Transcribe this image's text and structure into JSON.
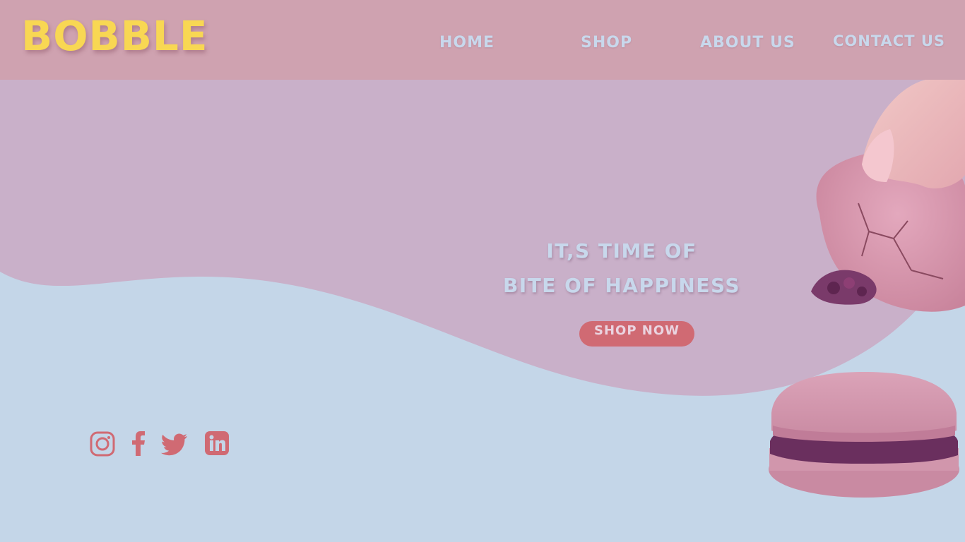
{
  "brand": {
    "name": "BOBBLE",
    "color": "#f8d753"
  },
  "nav": {
    "home": "HOME",
    "shop": "SHOP",
    "about": "ABOUT US",
    "contact": "CONTACT US"
  },
  "hero": {
    "line1": "IT,S TIME OF",
    "line2": "BITE OF HAPPINESS",
    "cta_label": "SHOP NOW"
  },
  "social": {
    "icons": [
      "instagram-icon",
      "facebook-icon",
      "twitter-icon",
      "linkedin-icon"
    ]
  },
  "colors": {
    "header_bg": "#cfa2b0",
    "wave_top": "#c9b0c9",
    "page_bg": "#c4d6e8",
    "accent": "#d06a73",
    "nav_text": "#c8d8ec"
  },
  "images": [
    "bitten-macaron-in-hand",
    "whole-macaron"
  ]
}
